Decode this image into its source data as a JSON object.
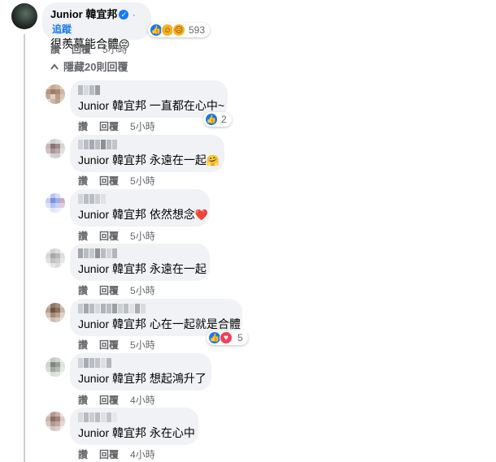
{
  "main_comment": {
    "author": "Junior 韓宜邦",
    "follow_label": "追蹤",
    "separator": "·",
    "text": "很羨慕能合體",
    "emoji": "😔",
    "reaction_count": "593",
    "actions": {
      "like": "讚",
      "reply": "回覆",
      "time": "5小時"
    }
  },
  "hidden_replies_label": "隱藏20則回覆",
  "replies": [
    {
      "text": "Junior 韓宜邦 一直都在心中~",
      "emoji": "",
      "like": "讚",
      "reply": "回覆",
      "time": "5小時",
      "reaction_count": "2"
    },
    {
      "text": "Junior 韓宜邦 永遠在一起",
      "emoji": "🤗",
      "like": "讚",
      "reply": "回覆",
      "time": "5小時",
      "reaction_count": ""
    },
    {
      "text": "Junior 韓宜邦 依然想念",
      "emoji": "❤️",
      "like": "讚",
      "reply": "回覆",
      "time": "5小時",
      "reaction_count": ""
    },
    {
      "text": "Junior 韓宜邦 永遠在一起",
      "emoji": "",
      "like": "讚",
      "reply": "回覆",
      "time": "5小時",
      "reaction_count": ""
    },
    {
      "text": "Junior 韓宜邦 心在一起就是合體",
      "emoji": "",
      "like": "讚",
      "reply": "回覆",
      "time": "5小時",
      "reaction_count": "5"
    },
    {
      "text": "Junior 韓宜邦 想起鴻升了",
      "emoji": "",
      "like": "讚",
      "reply": "回覆",
      "time": "4小時",
      "reaction_count": ""
    },
    {
      "text": "Junior 韓宜邦 永在心中",
      "emoji": "",
      "like": "讚",
      "reply": "回覆",
      "time": "4小時",
      "reaction_count": ""
    }
  ],
  "colors": {
    "accent": "#1877f2",
    "bubble": "#f0f2f5",
    "muted": "#65676b"
  }
}
